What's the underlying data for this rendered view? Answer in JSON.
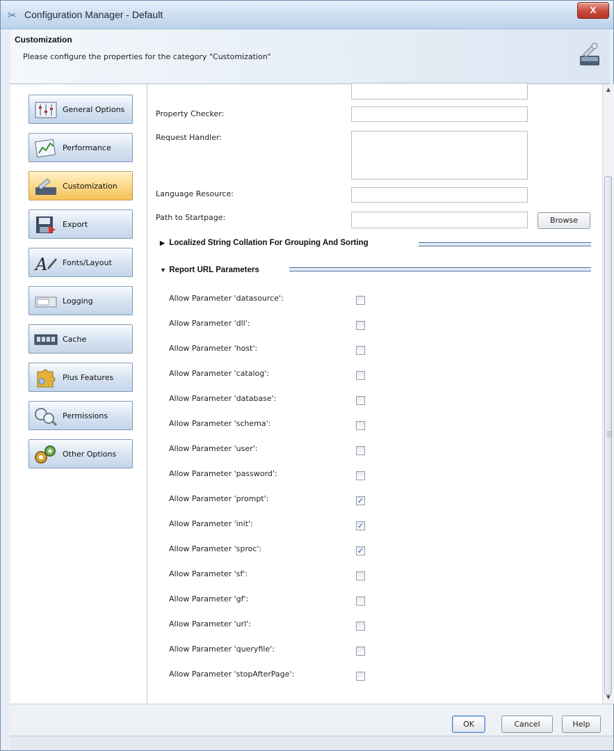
{
  "window": {
    "title": "Configuration Manager - Default",
    "close_label": "X"
  },
  "header": {
    "title": "Customization",
    "subtitle": "Please configure the properties for the category \"Customization\""
  },
  "sidebar": {
    "items": [
      {
        "label": "General Options",
        "icon": "sliders-icon"
      },
      {
        "label": "Performance",
        "icon": "chart-icon"
      },
      {
        "label": "Customization",
        "icon": "wrench-icon",
        "active": true
      },
      {
        "label": "Export",
        "icon": "export-icon"
      },
      {
        "label": "Fonts/Layout",
        "icon": "font-icon"
      },
      {
        "label": "Logging",
        "icon": "log-icon"
      },
      {
        "label": "Cache",
        "icon": "memory-icon"
      },
      {
        "label": "Plus Features",
        "icon": "puzzle-icon"
      },
      {
        "label": "Permissions",
        "icon": "key-icon"
      },
      {
        "label": "Other Options",
        "icon": "gear-icon"
      }
    ]
  },
  "form": {
    "property_checker_label": "Property Checker:",
    "request_handler_label": "Request Handler:",
    "language_resource_label": "Language Resource:",
    "path_to_startpage_label": "Path to Startpage:",
    "browse_label": "Browse",
    "section_collation": "Localized String Collation For Grouping And Sorting",
    "section_url_params": "Report URL Parameters"
  },
  "params": [
    {
      "label": "Allow Parameter 'datasource':",
      "checked": false
    },
    {
      "label": "Allow Parameter 'dll':",
      "checked": false
    },
    {
      "label": "Allow Parameter 'host':",
      "checked": false
    },
    {
      "label": "Allow Parameter 'catalog':",
      "checked": false
    },
    {
      "label": "Allow Parameter 'database':",
      "checked": false
    },
    {
      "label": "Allow Parameter 'schema':",
      "checked": false
    },
    {
      "label": "Allow Parameter 'user':",
      "checked": false
    },
    {
      "label": "Allow Parameter 'password':",
      "checked": false
    },
    {
      "label": "Allow Parameter 'prompt':",
      "checked": true
    },
    {
      "label": "Allow Parameter 'init':",
      "checked": true
    },
    {
      "label": "Allow Parameter 'sproc':",
      "checked": true
    },
    {
      "label": "Allow Parameter 'sf':",
      "checked": false
    },
    {
      "label": "Allow Parameter 'gf':",
      "checked": false
    },
    {
      "label": "Allow Parameter 'url':",
      "checked": false
    },
    {
      "label": "Allow Parameter 'queryfile':",
      "checked": false
    },
    {
      "label": "Allow Parameter 'stopAfterPage':",
      "checked": false
    }
  ],
  "footer": {
    "ok": "OK",
    "cancel": "Cancel",
    "help": "Help"
  }
}
